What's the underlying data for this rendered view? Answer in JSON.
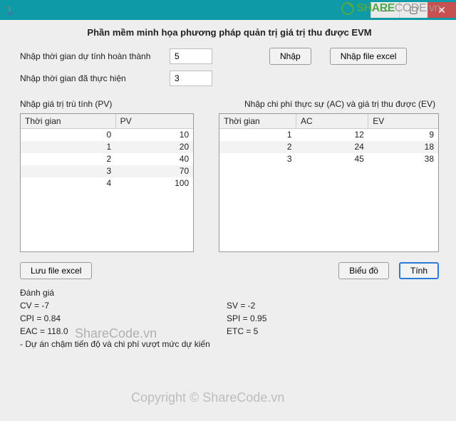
{
  "titlebar": {
    "java_icon": "java-icon"
  },
  "app_title": "Phần mềm minh họa phương pháp quản trị giá trị thu được EVM",
  "form": {
    "label_est_complete": "Nhập thời gian dự tính hoàn thành",
    "value_est_complete": "5",
    "label_actual": "Nhập thời gian đã thực hiện",
    "value_actual": "3",
    "btn_input": "Nhập",
    "btn_input_excel": "Nhập file excel"
  },
  "sections": {
    "pv_label": "Nhập giá trị trù tính (PV)",
    "acev_label": "Nhập chi phí thực sự (AC) và giá trị thu được (EV)"
  },
  "tables": {
    "pv": {
      "cols": [
        "Thời gian",
        "PV"
      ],
      "rows": [
        [
          "0",
          "10"
        ],
        [
          "1",
          "20"
        ],
        [
          "2",
          "40"
        ],
        [
          "3",
          "70"
        ],
        [
          "4",
          "100"
        ]
      ]
    },
    "acev": {
      "cols": [
        "Thời gian",
        "AC",
        "EV"
      ],
      "rows": [
        [
          "1",
          "12",
          "9"
        ],
        [
          "2",
          "24",
          "18"
        ],
        [
          "3",
          "45",
          "38"
        ]
      ]
    }
  },
  "buttons": {
    "save_excel": "Lưu file excel",
    "chart": "Biểu đồ",
    "compute": "Tính"
  },
  "eval": {
    "heading": "Đánh giá",
    "cv": "CV = -7",
    "sv": "SV = -2",
    "cpi": "CPI = 0.84",
    "spi": "SPI = 0.95",
    "eac": "EAC = 118.0",
    "etc": "ETC = 5",
    "note": "- Dự án chậm tiến độ và chi phí vượt mức dự kiến"
  },
  "watermark1": "ShareCode.vn",
  "watermark2": "Copyright © ShareCode.vn",
  "logo": {
    "share": "SHARE",
    "code": "CODE",
    "vn": ".vn"
  }
}
